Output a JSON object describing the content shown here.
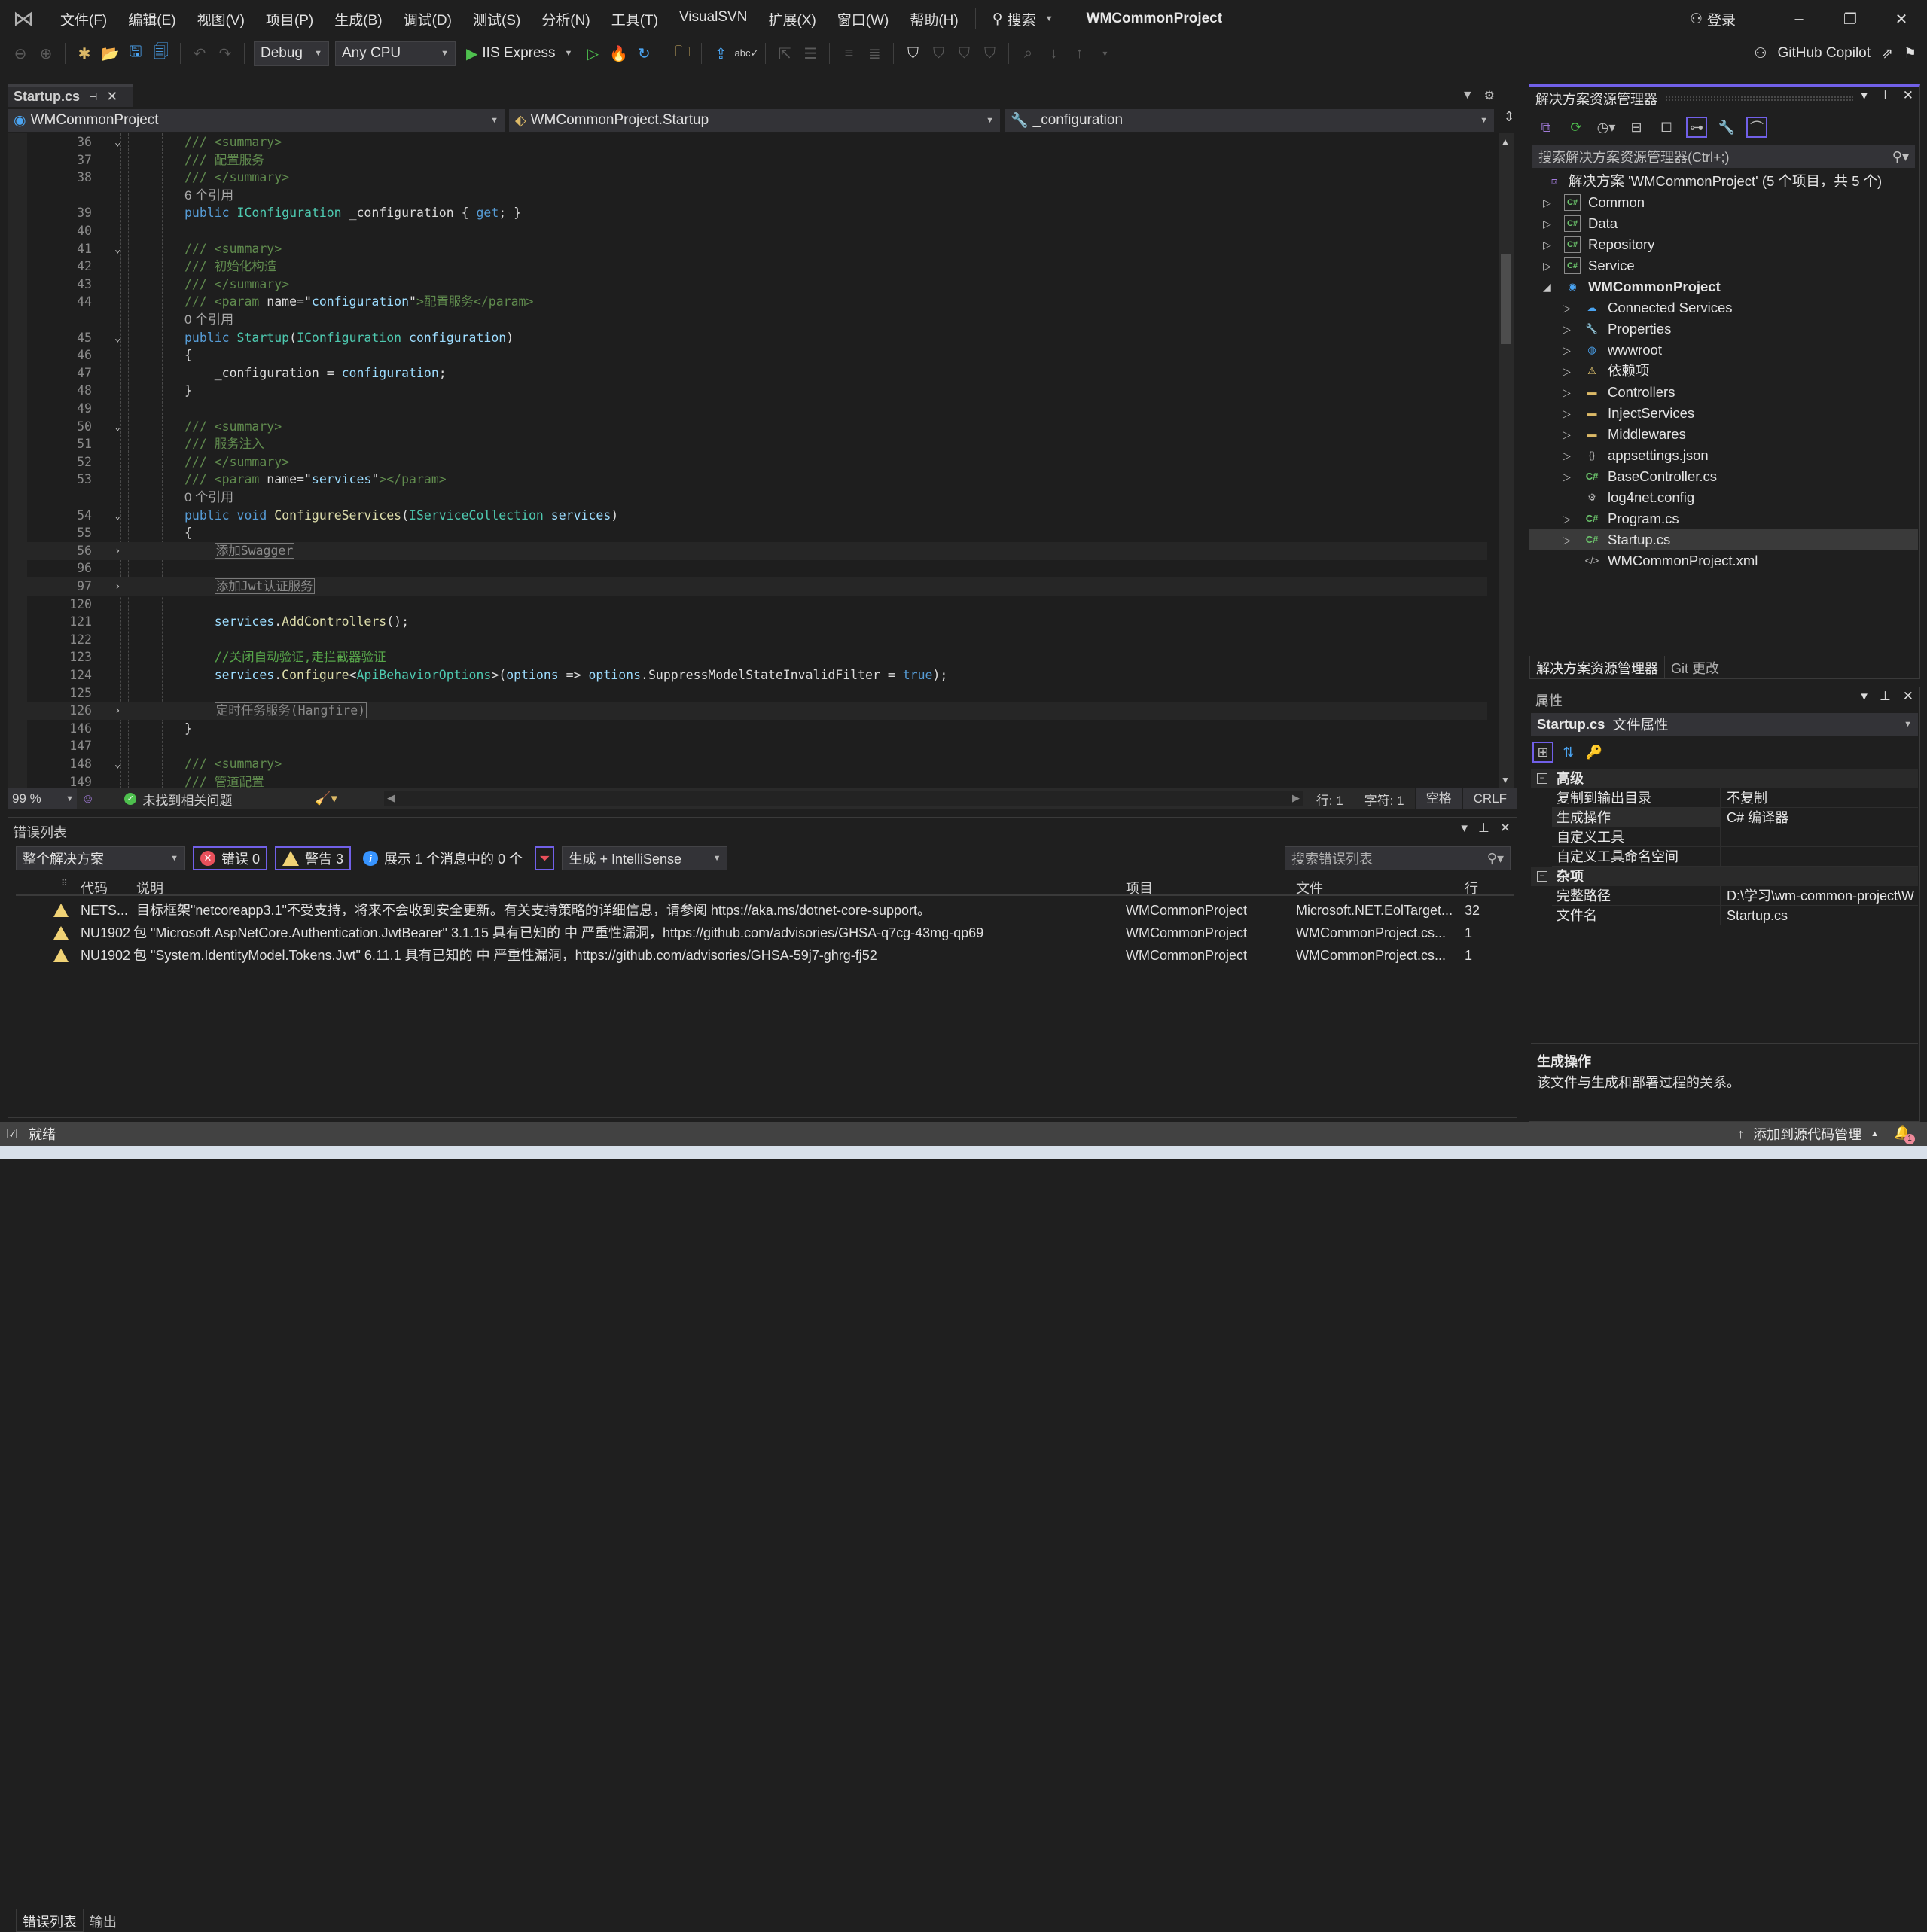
{
  "menu": {
    "items": [
      "文件(F)",
      "编辑(E)",
      "视图(V)",
      "项目(P)",
      "生成(B)",
      "调试(D)",
      "测试(S)",
      "分析(N)",
      "工具(T)",
      "VisualSVN",
      "扩展(X)",
      "窗口(W)",
      "帮助(H)"
    ],
    "search_label": "搜索",
    "title": "WMCommonProject",
    "signin_label": "登录"
  },
  "toolbar": {
    "config": "Debug",
    "platform": "Any CPU",
    "run_target": "IIS Express",
    "copilot_label": "GitHub Copilot"
  },
  "editor": {
    "tab_label": "Startup.cs",
    "nav_project": "WMCommonProject",
    "nav_class": "WMCommonProject.Startup",
    "nav_member": "_configuration",
    "zoom": "99 %",
    "issues_label": "未找到相关问题",
    "line": "行: 1",
    "char": "字符: 1",
    "indent": "空格",
    "eol": "CRLF"
  },
  "code_lines": [
    {
      "n": "36",
      "fold": "v",
      "segs": [
        [
          "xd",
          "/// <summary>"
        ]
      ]
    },
    {
      "n": "37",
      "segs": [
        [
          "xd",
          "/// 配置服务"
        ]
      ]
    },
    {
      "n": "38",
      "segs": [
        [
          "xd",
          "/// </summary>"
        ]
      ]
    },
    {
      "n": "",
      "ref": "6 个引用"
    },
    {
      "n": "39",
      "segs": [
        [
          "kw",
          "public "
        ],
        [
          "ty",
          "IConfiguration "
        ],
        [
          "pl",
          "_configuration { "
        ],
        [
          "kw",
          "get"
        ],
        [
          "pl",
          "; }"
        ]
      ]
    },
    {
      "n": "40",
      "segs": []
    },
    {
      "n": "41",
      "fold": "v",
      "segs": [
        [
          "xd",
          "/// <summary>"
        ]
      ]
    },
    {
      "n": "42",
      "segs": [
        [
          "xd",
          "/// 初始化构造"
        ]
      ]
    },
    {
      "n": "43",
      "segs": [
        [
          "xd",
          "/// </summary>"
        ]
      ]
    },
    {
      "n": "44",
      "segs": [
        [
          "xd",
          "/// <param "
        ],
        [
          "pl",
          "name=\""
        ],
        [
          "id",
          "configuration"
        ],
        [
          "pl",
          "\""
        ],
        [
          "xd",
          ">配置服务</param>"
        ]
      ]
    },
    {
      "n": "",
      "ref": "0 个引用"
    },
    {
      "n": "45",
      "fold": "v",
      "segs": [
        [
          "kw",
          "public "
        ],
        [
          "ty",
          "Startup"
        ],
        [
          "pl",
          "("
        ],
        [
          "ty",
          "IConfiguration "
        ],
        [
          "id",
          "configuration"
        ],
        [
          "pl",
          ")"
        ]
      ]
    },
    {
      "n": "46",
      "segs": [
        [
          "pl",
          "{"
        ]
      ]
    },
    {
      "n": "47",
      "segs": [
        [
          "pl",
          "    _configuration = "
        ],
        [
          "id",
          "configuration"
        ],
        [
          "pl",
          ";"
        ]
      ]
    },
    {
      "n": "48",
      "segs": [
        [
          "pl",
          "}"
        ]
      ]
    },
    {
      "n": "49",
      "segs": []
    },
    {
      "n": "50",
      "fold": "v",
      "segs": [
        [
          "xd",
          "/// <summary>"
        ]
      ]
    },
    {
      "n": "51",
      "segs": [
        [
          "xd",
          "/// 服务注入"
        ]
      ]
    },
    {
      "n": "52",
      "segs": [
        [
          "xd",
          "/// </summary>"
        ]
      ]
    },
    {
      "n": "53",
      "segs": [
        [
          "xd",
          "/// <param "
        ],
        [
          "pl",
          "name=\""
        ],
        [
          "id",
          "services"
        ],
        [
          "pl",
          "\""
        ],
        [
          "xd",
          "></param>"
        ]
      ]
    },
    {
      "n": "",
      "ref": "0 个引用"
    },
    {
      "n": "54",
      "fold": "v",
      "segs": [
        [
          "kw",
          "public void "
        ],
        [
          "fn",
          "ConfigureServices"
        ],
        [
          "pl",
          "("
        ],
        [
          "ty",
          "IServiceCollection "
        ],
        [
          "id",
          "services"
        ],
        [
          "pl",
          ")"
        ]
      ]
    },
    {
      "n": "55",
      "segs": [
        [
          "pl",
          "{"
        ]
      ]
    },
    {
      "n": "56",
      "fold": ">",
      "hl": true,
      "segs": [
        [
          "pl",
          "    "
        ],
        [
          "coll",
          "添加Swagger"
        ]
      ]
    },
    {
      "n": "96",
      "segs": []
    },
    {
      "n": "97",
      "fold": ">",
      "hl": true,
      "segs": [
        [
          "pl",
          "    "
        ],
        [
          "coll",
          "添加Jwt认证服务"
        ]
      ]
    },
    {
      "n": "120",
      "segs": []
    },
    {
      "n": "121",
      "segs": [
        [
          "id",
          "    services"
        ],
        [
          "pl",
          "."
        ],
        [
          "fn",
          "AddControllers"
        ],
        [
          "pl",
          "();"
        ]
      ]
    },
    {
      "n": "122",
      "segs": []
    },
    {
      "n": "123",
      "segs": [
        [
          "cm",
          "    //关闭自动验证,走拦截器验证"
        ]
      ]
    },
    {
      "n": "124",
      "segs": [
        [
          "id",
          "    services"
        ],
        [
          "pl",
          "."
        ],
        [
          "fn",
          "Configure"
        ],
        [
          "pl",
          "<"
        ],
        [
          "ty",
          "ApiBehaviorOptions"
        ],
        [
          "pl",
          ">("
        ],
        [
          "id",
          "options"
        ],
        [
          "pl",
          " => "
        ],
        [
          "id",
          "options"
        ],
        [
          "pl",
          ".SuppressModelStateInvalidFilter = "
        ],
        [
          "kw",
          "true"
        ],
        [
          "pl",
          ");"
        ]
      ]
    },
    {
      "n": "125",
      "segs": []
    },
    {
      "n": "126",
      "fold": ">",
      "hl": true,
      "segs": [
        [
          "pl",
          "    "
        ],
        [
          "coll",
          "定时任务服务(Hangfire)"
        ]
      ]
    },
    {
      "n": "146",
      "segs": [
        [
          "pl",
          "}"
        ]
      ]
    },
    {
      "n": "147",
      "segs": []
    },
    {
      "n": "148",
      "fold": "v",
      "segs": [
        [
          "xd",
          "/// <summary>"
        ]
      ]
    },
    {
      "n": "149",
      "segs": [
        [
          "xd",
          "/// 管道配置"
        ]
      ]
    }
  ],
  "error_list": {
    "title": "错误列表",
    "scope": "整个解决方案",
    "errors_label": "错误 0",
    "warnings_label": "警告 3",
    "messages_label": "展示 1 个消息中的 0 个",
    "source": "生成 + IntelliSense",
    "search_placeholder": "搜索错误列表",
    "columns": {
      "code": "代码",
      "desc": "说明",
      "project": "项目",
      "file": "文件",
      "line": "行"
    },
    "rows": [
      {
        "code": "NETS...",
        "desc": "目标框架\"netcoreapp3.1\"不受支持，将来不会收到安全更新。有关支持策略的详细信息，请参阅 https://aka.ms/dotnet-core-support。",
        "project": "WMCommonProject",
        "file": "Microsoft.NET.EolTarget...",
        "line": "32"
      },
      {
        "code": "NU1902",
        "desc": "包 \"Microsoft.AspNetCore.Authentication.JwtBearer\" 3.1.15 具有已知的 中 严重性漏洞，https://github.com/advisories/GHSA-q7cg-43mg-qp69",
        "project": "WMCommonProject",
        "file": "WMCommonProject.cs...",
        "line": "1"
      },
      {
        "code": "NU1902",
        "desc": "包 \"System.IdentityModel.Tokens.Jwt\" 6.11.1 具有已知的 中 严重性漏洞，https://github.com/advisories/GHSA-59j7-ghrg-fj52",
        "project": "WMCommonProject",
        "file": "WMCommonProject.cs...",
        "line": "1"
      }
    ],
    "tabs": [
      "错误列表",
      "输出"
    ]
  },
  "solution_explorer": {
    "title": "解决方案资源管理器",
    "search_placeholder": "搜索解决方案资源管理器(Ctrl+;)",
    "solution_label": "解决方案 'WMCommonProject' (5 个项目，共 5 个)",
    "items": [
      {
        "label": "Common",
        "level": 0,
        "icon": "cs-project",
        "expand": "closed"
      },
      {
        "label": "Data",
        "level": 0,
        "icon": "cs-project",
        "expand": "closed"
      },
      {
        "label": "Repository",
        "level": 0,
        "icon": "cs-project",
        "expand": "closed"
      },
      {
        "label": "Service",
        "level": 0,
        "icon": "cs-project",
        "expand": "closed"
      },
      {
        "label": "WMCommonProject",
        "level": 0,
        "icon": "web-project",
        "expand": "open",
        "bold": true
      },
      {
        "label": "Connected Services",
        "level": 1,
        "icon": "connected-services",
        "expand": "closed"
      },
      {
        "label": "Properties",
        "level": 1,
        "icon": "properties",
        "expand": "closed"
      },
      {
        "label": "wwwroot",
        "level": 1,
        "icon": "globe",
        "expand": "closed"
      },
      {
        "label": "依赖项",
        "level": 1,
        "icon": "dependencies-warning",
        "expand": "closed"
      },
      {
        "label": "Controllers",
        "level": 1,
        "icon": "folder",
        "expand": "closed"
      },
      {
        "label": "InjectServices",
        "level": 1,
        "icon": "folder",
        "expand": "closed"
      },
      {
        "label": "Middlewares",
        "level": 1,
        "icon": "folder",
        "expand": "closed"
      },
      {
        "label": "appsettings.json",
        "level": 1,
        "icon": "json-file",
        "expand": "closed"
      },
      {
        "label": "BaseController.cs",
        "level": 1,
        "icon": "cs-file",
        "expand": "closed"
      },
      {
        "label": "log4net.config",
        "level": 1,
        "icon": "config-file",
        "expand": "none"
      },
      {
        "label": "Program.cs",
        "level": 1,
        "icon": "cs-file",
        "expand": "closed"
      },
      {
        "label": "Startup.cs",
        "level": 1,
        "icon": "cs-file",
        "expand": "closed",
        "selected": true
      },
      {
        "label": "WMCommonProject.xml",
        "level": 1,
        "icon": "xml-file",
        "expand": "none"
      }
    ],
    "tabs": [
      "解决方案资源管理器",
      "Git 更改"
    ]
  },
  "properties": {
    "title": "属性",
    "object_name": "Startup.cs",
    "object_type": "文件属性",
    "categories": [
      {
        "name": "高级",
        "rows": [
          {
            "key": "复制到输出目录",
            "value": "不复制"
          },
          {
            "key": "生成操作",
            "value": "C# 编译器",
            "selected": true
          },
          {
            "key": "自定义工具",
            "value": ""
          },
          {
            "key": "自定义工具命名空间",
            "value": ""
          }
        ]
      },
      {
        "name": "杂项",
        "rows": [
          {
            "key": "完整路径",
            "value": "D:\\学习\\wm-common-project\\W"
          },
          {
            "key": "文件名",
            "value": "Startup.cs"
          }
        ]
      }
    ],
    "desc_title": "生成操作",
    "desc_text": "该文件与生成和部署过程的关系。"
  },
  "statusbar": {
    "ready": "就绪",
    "source_control": "添加到源代码管理",
    "notifications": "1"
  }
}
